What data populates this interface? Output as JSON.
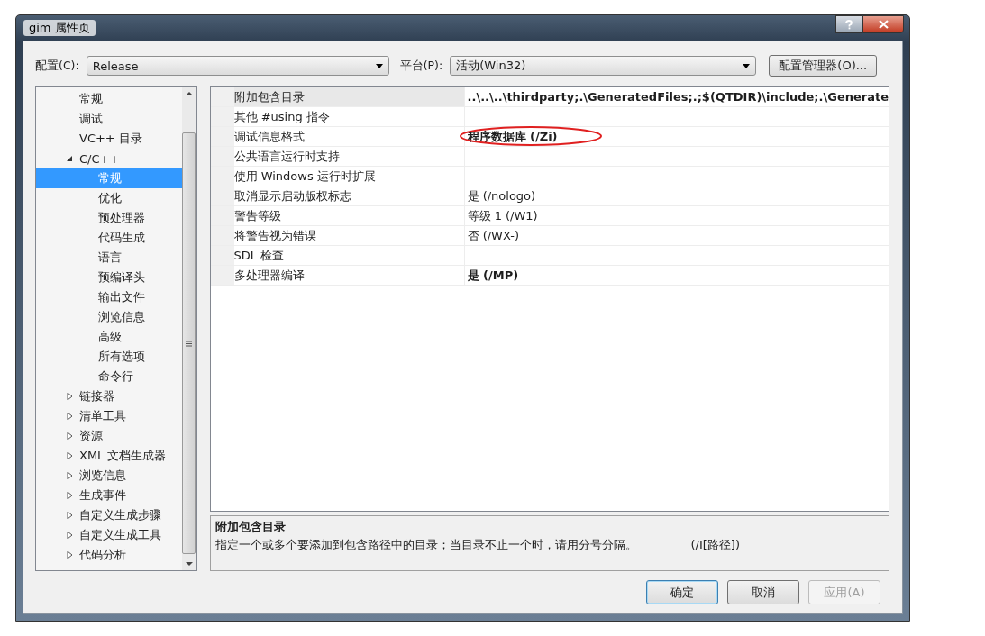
{
  "window": {
    "title": "gim 属性页"
  },
  "config_label": "配置(C):",
  "config_value": "Release",
  "platform_label": "平台(P):",
  "platform_value": "活动(Win32)",
  "config_manager_button": "配置管理器(O)...",
  "tree": [
    {
      "label": "常规",
      "selected": false
    },
    {
      "label": "调试",
      "selected": false
    },
    {
      "label": "VC++ 目录",
      "selected": false
    },
    {
      "label": "C/C++",
      "expanded": true,
      "selected": false,
      "children": [
        {
          "label": "常规",
          "selected": true
        },
        {
          "label": "优化",
          "selected": false
        },
        {
          "label": "预处理器",
          "selected": false
        },
        {
          "label": "代码生成",
          "selected": false
        },
        {
          "label": "语言",
          "selected": false
        },
        {
          "label": "预编译头",
          "selected": false
        },
        {
          "label": "输出文件",
          "selected": false
        },
        {
          "label": "浏览信息",
          "selected": false
        },
        {
          "label": "高级",
          "selected": false
        },
        {
          "label": "所有选项",
          "selected": false
        },
        {
          "label": "命令行",
          "selected": false
        }
      ]
    },
    {
      "label": "链接器",
      "expanded": false,
      "selected": false
    },
    {
      "label": "清单工具",
      "expanded": false,
      "selected": false
    },
    {
      "label": "资源",
      "expanded": false,
      "selected": false
    },
    {
      "label": "XML 文档生成器",
      "expanded": false,
      "selected": false
    },
    {
      "label": "浏览信息",
      "expanded": false,
      "selected": false
    },
    {
      "label": "生成事件",
      "expanded": false,
      "selected": false
    },
    {
      "label": "自定义生成步骤",
      "expanded": false,
      "selected": false
    },
    {
      "label": "自定义生成工具",
      "expanded": false,
      "selected": false
    },
    {
      "label": "代码分析",
      "expanded": false,
      "selected": false
    }
  ],
  "properties": [
    {
      "name": "附加包含目录",
      "value": "..\\..\\..\\thirdparty;.\\GeneratedFiles;.;$(QTDIR)\\include;.\\Generate",
      "bold": true,
      "selected": true,
      "circled": false
    },
    {
      "name": "其他 #using 指令",
      "selected": false,
      "circled": false
    },
    {
      "name": "调试信息格式",
      "value": "程序数据库 (/Zi)",
      "bold": true,
      "selected": false,
      "circled": true
    },
    {
      "name": "公共语言运行时支持",
      "selected": false,
      "circled": false
    },
    {
      "name": "使用 Windows 运行时扩展",
      "selected": false,
      "circled": false
    },
    {
      "name": "取消显示启动版权标志",
      "value": "是 (/nologo)",
      "bold": false,
      "selected": false,
      "circled": false
    },
    {
      "name": "警告等级",
      "value": "等级 1 (/W1)",
      "bold": false,
      "selected": false,
      "circled": false
    },
    {
      "name": "将警告视为错误",
      "value": "否 (/WX-)",
      "bold": false,
      "selected": false,
      "circled": false
    },
    {
      "name": "SDL 检查",
      "selected": false,
      "circled": false
    },
    {
      "name": "多处理器编译",
      "value": "是 (/MP)",
      "bold": true,
      "selected": false,
      "circled": false
    }
  ],
  "description": {
    "title": "附加包含目录",
    "text": "指定一个或多个要添加到包含路径中的目录；当目录不止一个时，请用分号分隔。",
    "switch": "(/I[路径])"
  },
  "buttons": [
    {
      "label": "确定",
      "disabled": false,
      "default": true
    },
    {
      "label": "取消",
      "disabled": false,
      "default": false
    },
    {
      "label": "应用(A)",
      "disabled": true,
      "default": false
    }
  ]
}
